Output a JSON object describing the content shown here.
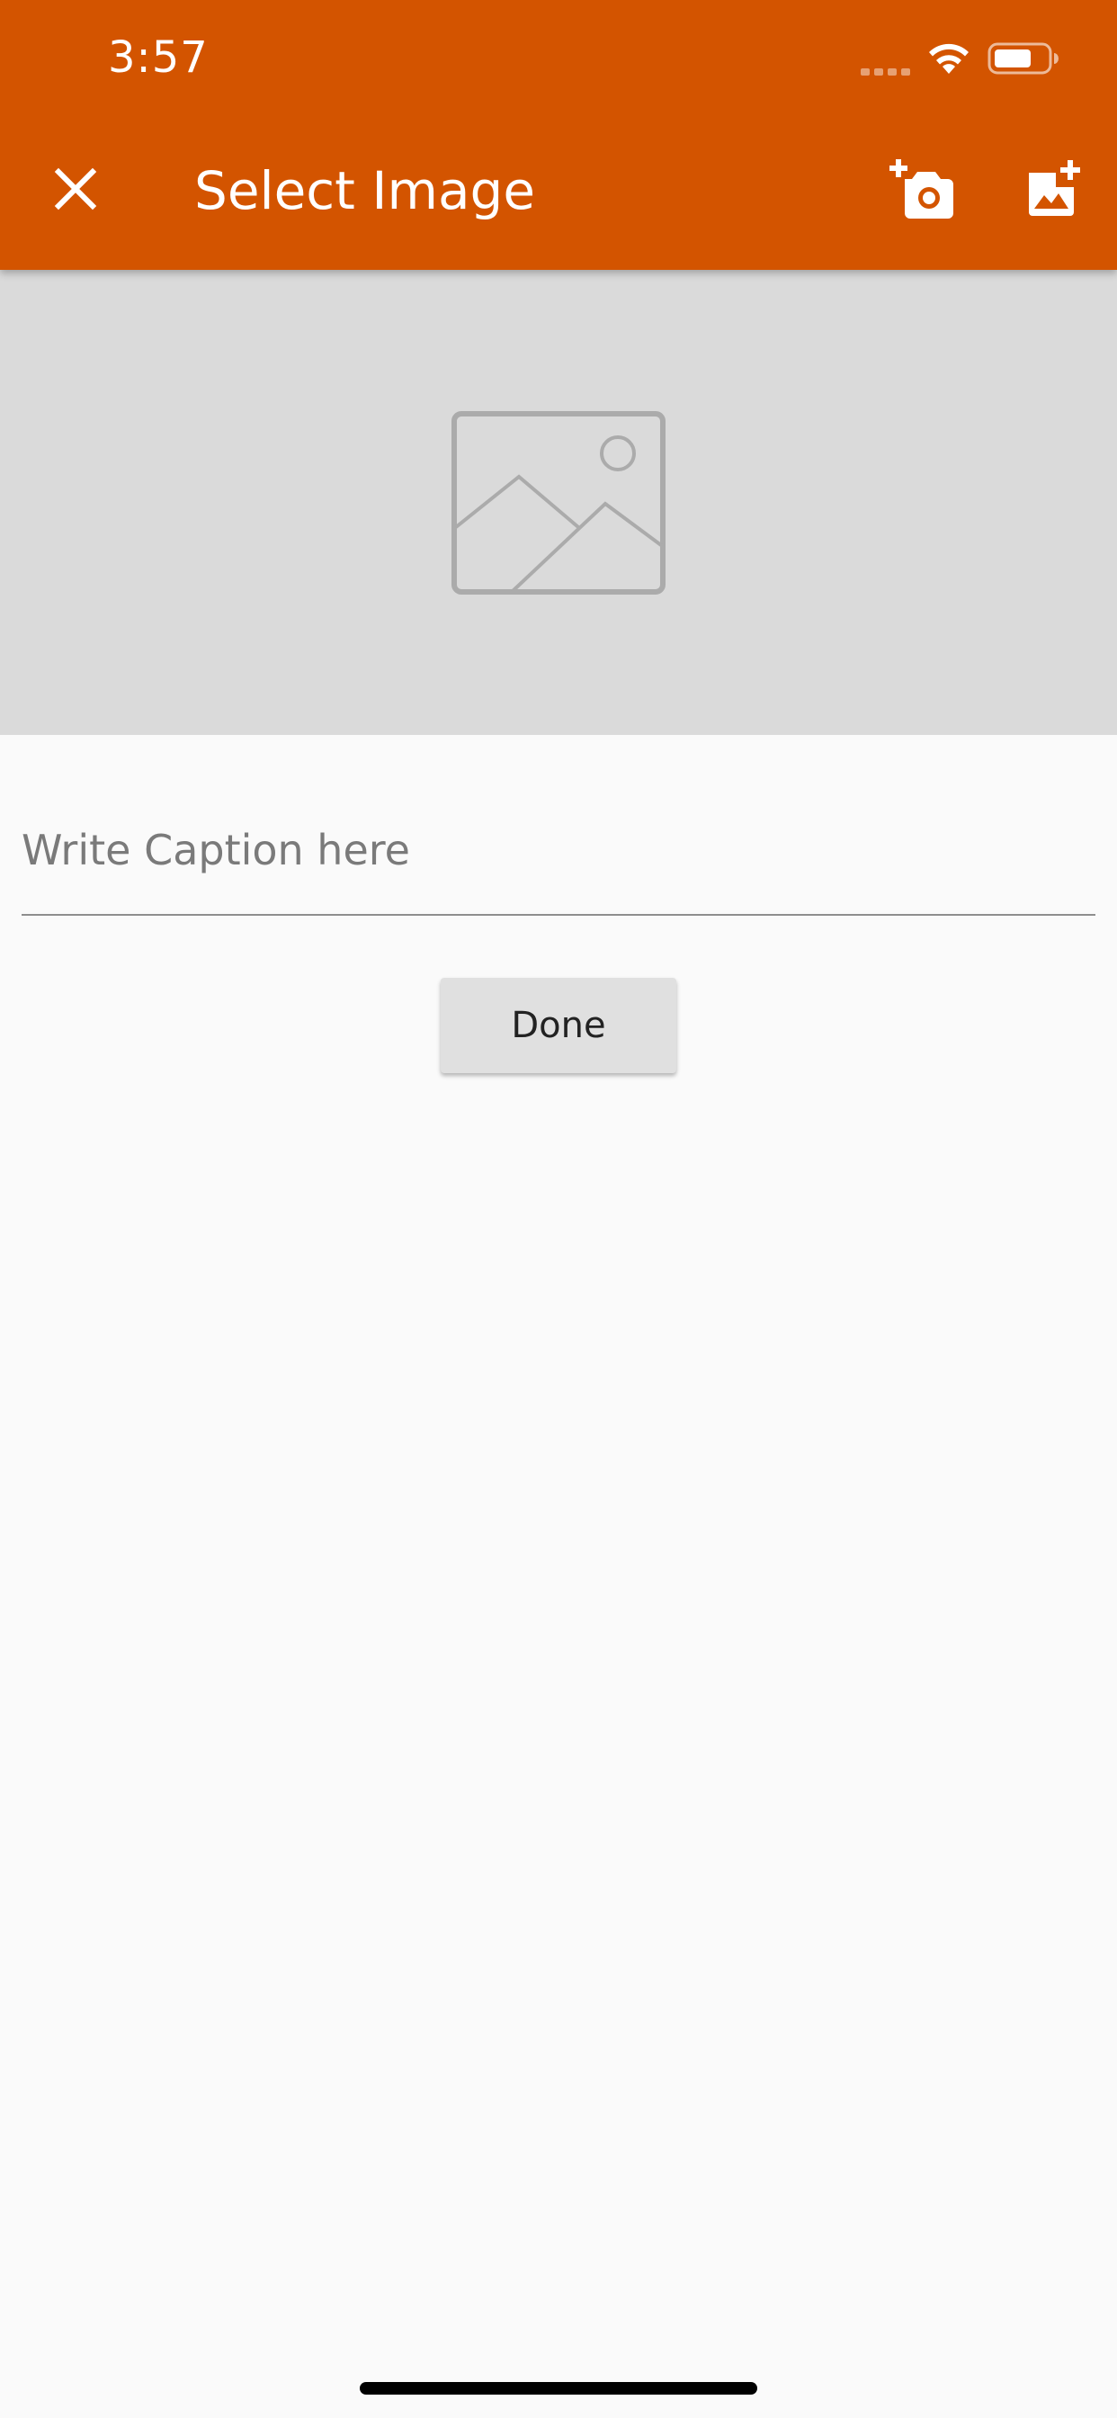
{
  "status_bar": {
    "time": "3:57",
    "icons": [
      "cellular-signal-icon",
      "wifi-icon",
      "battery-icon"
    ]
  },
  "app_bar": {
    "title": "Select Image",
    "leading_icon": "close-icon",
    "actions": [
      {
        "icon": "add-a-photo-icon",
        "label": "Take photo"
      },
      {
        "icon": "add-photo-alternate-icon",
        "label": "Pick from gallery"
      }
    ]
  },
  "preview": {
    "icon": "image-placeholder-icon"
  },
  "caption": {
    "value": "",
    "placeholder": "Write Caption here"
  },
  "done_button": {
    "label": "Done"
  },
  "colors": {
    "primary": "#D35400",
    "preview_background": "#DADADA",
    "page_background": "#FAFAFA",
    "button_background": "#E0E0E0"
  }
}
